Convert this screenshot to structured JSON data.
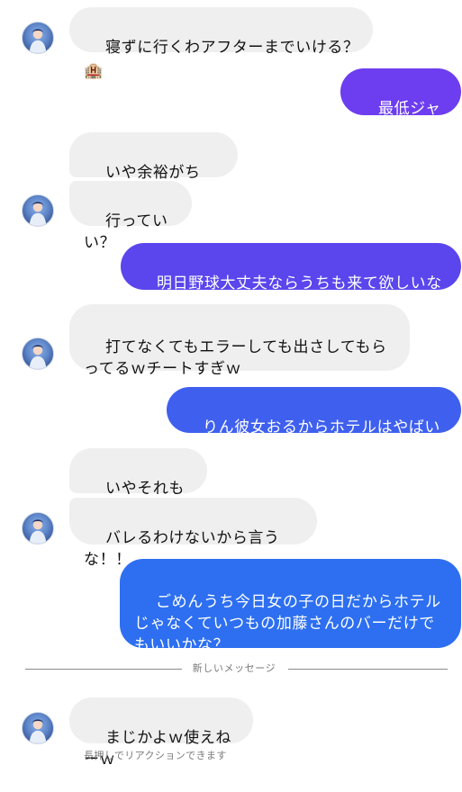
{
  "messages": {
    "m1": "寝ずに行くわアフターまでいける？",
    "m1_emoji": "🏨",
    "m2": "最低ジャンｗ",
    "m3": "いや余裕がちで！！",
    "m4": "行っていい？",
    "m5": "明日野球大丈夫ならうちも来て欲しいなー",
    "m5_emoji": "❤",
    "m6": "打てなくてもエラーしても出さしてもらってるｗチートすぎｗ",
    "m7": "りん彼女おるからホテルはやばいよ？",
    "m8": "いやそれも余裕",
    "m9": "バレるわけないから言うな！！",
    "m10": "ごめんうち今日女の子の日だからホテルじゃなくていつもの加藤さんのバーだけでもいいかな？",
    "m11": "まじかよｗ使えねーｗ"
  },
  "divider": {
    "label": "新しいメッセージ"
  },
  "hint": "長押しでリアクションできます",
  "colors": {
    "incoming_bubble": "#efefef",
    "outgoing_violet": "#6d3df0",
    "outgoing_indigo": "#5a46ec",
    "outgoing_blue_1": "#3f60ee",
    "outgoing_blue_2": "#2d6ff0",
    "background": "#ffffff"
  },
  "icons": {
    "avatar": "profile-avatar-icon",
    "hotel": "hotel-emoji-icon",
    "heart": "heart-emoji-icon"
  }
}
